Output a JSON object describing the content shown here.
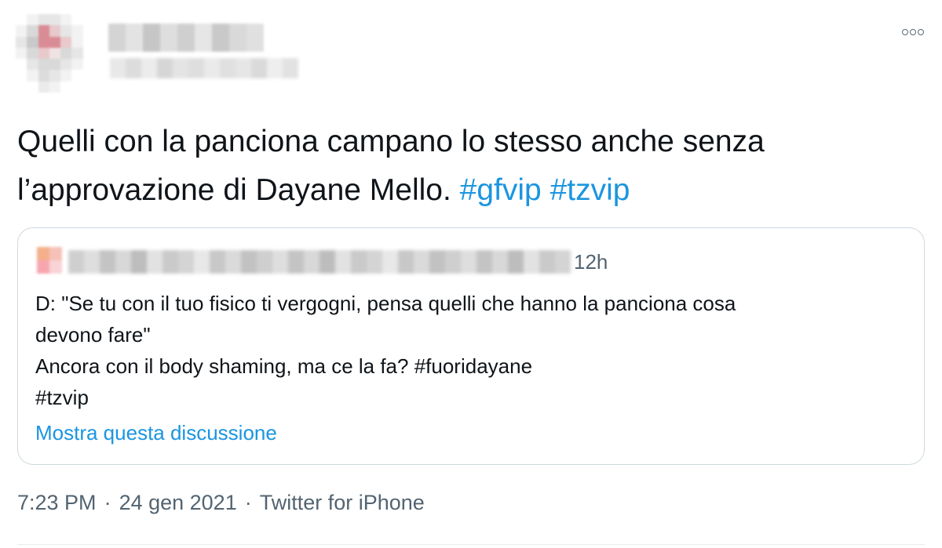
{
  "tweet": {
    "text_line1": "Quelli con la panciona campano lo stesso anche senza",
    "text_line2": "l’approvazione di Dayane Mello. ",
    "hashtags": [
      "#gfvip",
      "#tzvip"
    ],
    "more_icon": "more-horizontal-icon"
  },
  "quote": {
    "time": "12h",
    "text": "D: \"Se tu con il tuo fisico ti vergogni, pensa quelli che hanno la panciona cosa\ndevono fare\"\nAncora con il body shaming, ma ce la fa? #fuoridayane\n#tzvip",
    "thread_link": "Mostra questa discussione"
  },
  "meta": {
    "time": "7:23 PM",
    "date": "24 gen 2021",
    "separator": "·",
    "source": "Twitter for iPhone"
  },
  "colors": {
    "link": "#1b95e0",
    "text": "#0f1419",
    "muted": "#536471",
    "border": "#cfd9de"
  }
}
